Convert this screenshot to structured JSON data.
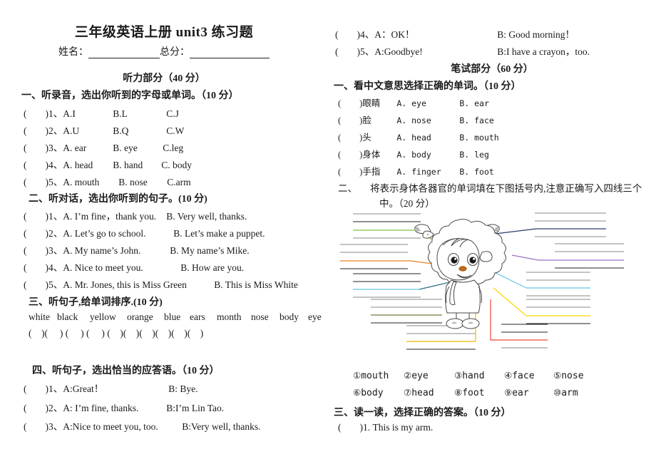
{
  "header": {
    "title": "三年级英语上册 unit3 练习题",
    "name_label": "姓名：",
    "score_label": "总分："
  },
  "listening_part": {
    "title": "听力部分（40 分）",
    "sections": [
      {
        "heading": "一、听录音，选出你听到的字母或单词。（10 分）",
        "items": [
          {
            "num": "1、",
            "a": "A.I",
            "b": "B.L",
            "c": "C.J"
          },
          {
            "num": "2、",
            "a": "A.U",
            "b": "B.Q",
            "c": "C.W"
          },
          {
            "num": "3、",
            "a": "A. ear",
            "b": "B. eye",
            "c": "C.leg"
          },
          {
            "num": "4、",
            "a": "A. head",
            "b": "B. hand",
            "c": "C. body"
          },
          {
            "num": "5、",
            "a": "A. mouth",
            "b": "B. nose",
            "c": "C.arm"
          }
        ]
      },
      {
        "heading": "二、听对话，选出你听到的句子。(10 分)",
        "items": [
          {
            "num": "1、",
            "a": "A. I’m fine，thank you.",
            "b": "B. Very well, thanks."
          },
          {
            "num": "2、",
            "a": "A. Let’s go to school.",
            "b": "B. Let’s make a puppet."
          },
          {
            "num": "3、",
            "a": "A. My name’s John.",
            "b": "B. My name’s Mike."
          },
          {
            "num": "4、",
            "a": "A. Nice to meet you.",
            "b": "B. How are you."
          },
          {
            "num": "5、",
            "a": "A. Mr. Jones, this is Miss Green",
            "b": "B. This is Miss White"
          }
        ]
      },
      {
        "heading": "三、听句子,给单词排序.(10 分)",
        "words": [
          "white",
          "black",
          "yellow",
          "orange",
          "blue",
          "ears",
          "month",
          "nose",
          "body",
          "eye"
        ],
        "bracket_count": 10
      },
      {
        "heading": "四、听句子，选出恰当的应答语。（10 分）",
        "items": [
          {
            "num": "1、",
            "a": "A:Great！",
            "b": "B: Bye."
          },
          {
            "num": "2、",
            "a": "A: I’m fine, thanks.",
            "b": "B:I’m Lin Tao."
          },
          {
            "num": "3、",
            "a": "A:Nice to meet you, too.",
            "b": "B:Very well, thanks."
          },
          {
            "num": "4、",
            "a": "A：OK！",
            "b": "B: Good morning！"
          },
          {
            "num": "5、",
            "a": "A:Goodbye!",
            "b": "B:I have a crayon，too."
          }
        ]
      }
    ]
  },
  "written_part": {
    "title": "笔试部分（60 分）",
    "section_one": {
      "heading": "一、看中文意思选择正确的单词。（10 分）",
      "items": [
        {
          "cn": "眼睛",
          "a": "A. eye",
          "b": "B. ear"
        },
        {
          "cn": "脸",
          "a": "A. nose",
          "b": "B. face"
        },
        {
          "cn": "头",
          "a": "A. head",
          "b": "B. mouth"
        },
        {
          "cn": "身体",
          "a": "A. body",
          "b": "B. leg"
        },
        {
          "cn": "手指",
          "a": "A. finger",
          "b": "B. foot"
        }
      ]
    },
    "section_two": {
      "heading_num": "二、",
      "heading_line1": "将表示身体各器官的单词填在下图括号内,注意正确写入四线三个",
      "heading_line2": "中。（20 分）",
      "word_list": [
        {
          "num": "①",
          "word": "mouth"
        },
        {
          "num": "②",
          "word": "eye"
        },
        {
          "num": "③",
          "word": "hand"
        },
        {
          "num": "④",
          "word": "face"
        },
        {
          "num": "⑤",
          "word": "nose"
        },
        {
          "num": "⑥",
          "word": "body"
        },
        {
          "num": "⑦",
          "word": "head"
        },
        {
          "num": "⑧",
          "word": "foot"
        },
        {
          "num": "⑨",
          "word": "ear"
        },
        {
          "num": "⑩",
          "word": "arm"
        }
      ]
    },
    "section_three": {
      "heading": "三、读一读，选择正确的答案。（10 分）",
      "items": [
        {
          "num": "1.",
          "text": "This is my arm."
        }
      ]
    }
  },
  "diagram": {
    "leader_colors": {
      "green": "#7ac143",
      "orange": "#e8821e",
      "teal": "#2b6b7a",
      "lightblue": "#63c6e8",
      "navy": "#2a3b6e",
      "purple": "#9b6fc4",
      "yellow": "#ffd400",
      "gold": "#f5b800",
      "red": "#f0463c",
      "olive": "#6f7a3a"
    },
    "rule_color": "#808080",
    "rule_dark": "#1a1a1a"
  }
}
